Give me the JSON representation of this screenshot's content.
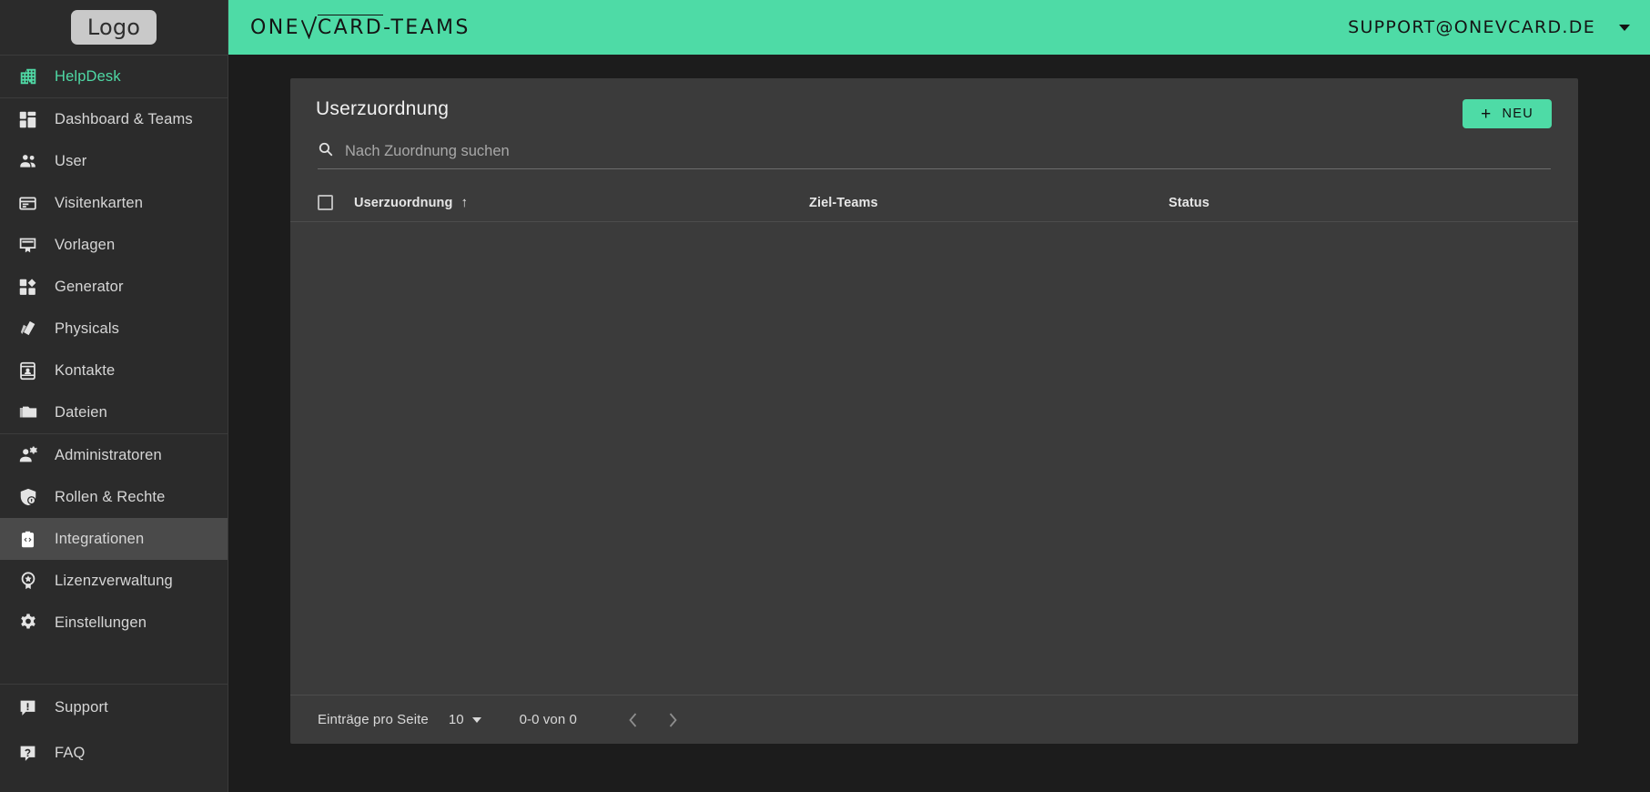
{
  "sidebar": {
    "logo_label": "Logo",
    "helpdesk": {
      "label": "HelpDesk",
      "icon": "building-icon"
    },
    "groups": [
      {
        "items": [
          {
            "label": "Dashboard & Teams",
            "icon": "dashboard-icon",
            "active": false
          },
          {
            "label": "User",
            "icon": "users-icon",
            "active": false
          },
          {
            "label": "Visitenkarten",
            "icon": "card-icon",
            "active": false
          },
          {
            "label": "Vorlagen",
            "icon": "template-icon",
            "active": false
          },
          {
            "label": "Generator",
            "icon": "generator-icon",
            "active": false
          },
          {
            "label": "Physicals",
            "icon": "physicals-icon",
            "active": false
          },
          {
            "label": "Kontakte",
            "icon": "contacts-icon",
            "active": false
          },
          {
            "label": "Dateien",
            "icon": "folder-icon",
            "active": false
          }
        ]
      },
      {
        "items": [
          {
            "label": "Administratoren",
            "icon": "admin-user-icon",
            "active": false
          },
          {
            "label": "Rollen & Rechte",
            "icon": "shield-lock-icon",
            "active": false
          },
          {
            "label": "Integrationen",
            "icon": "code-badge-icon",
            "active": true
          },
          {
            "label": "Lizenzverwaltung",
            "icon": "license-badge-icon",
            "active": false
          },
          {
            "label": "Einstellungen",
            "icon": "gear-icon",
            "active": false
          }
        ]
      },
      {
        "items": [
          {
            "label": "Support",
            "icon": "support-chat-icon",
            "active": false
          },
          {
            "label": "FAQ",
            "icon": "faq-question-icon",
            "active": false
          }
        ]
      }
    ]
  },
  "topbar": {
    "brand": "ONEVCARD-TEAMS",
    "brand_part1": "ONE",
    "brand_part2": "CARD",
    "brand_part3": "-TEAMS",
    "user_email": "SUPPORT@ONEVCARD.DE",
    "caret_icon": "chevron-down-icon",
    "background_color": "#4edba6"
  },
  "card": {
    "title": "Userzuordnung",
    "new_button": {
      "label": "NEU",
      "icon": "plus-icon"
    },
    "search": {
      "placeholder": "Nach Zuordnung suchen",
      "value": "",
      "icon": "search-icon"
    },
    "table": {
      "select_all_checked": false,
      "columns": [
        {
          "label": "Userzuordnung",
          "sorted": true,
          "sort_direction": "↑"
        },
        {
          "label": "Ziel-Teams",
          "sorted": false
        },
        {
          "label": "Status",
          "sorted": false
        }
      ],
      "rows": []
    },
    "footer": {
      "per_page_label": "Einträge pro Seite",
      "per_page_value": "10",
      "range_label": "0-0 von 0",
      "prev_icon": "chevron-left-icon",
      "next_icon": "chevron-right-icon"
    }
  },
  "colors": {
    "accent": "#4edba6",
    "sidebar_bg": "#2b2b2b",
    "page_bg": "#1c1c1c",
    "card_bg": "#3b3b3b",
    "active_item_bg": "#4a4a4a"
  }
}
